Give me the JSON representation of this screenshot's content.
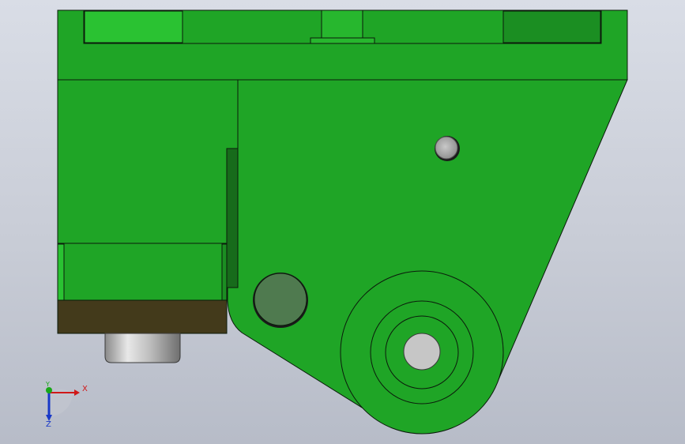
{
  "viewport": {
    "background_top": "#d9dde6",
    "background_bottom": "#b7bcc8"
  },
  "model": {
    "body_color": "#1fa526",
    "highlight_color": "#2ac232",
    "slot_color": "#176b1b",
    "pad_color": "#433a1b",
    "pin_color": "#c9c9c9",
    "boss_color": "#4f7a4f",
    "edge_color": "#0b1a0b"
  },
  "triad": {
    "x_label": "X",
    "y_label": "Y",
    "z_label": "Z",
    "x_color": "#d01818",
    "y_color": "#18a818",
    "z_color": "#1838c8"
  }
}
